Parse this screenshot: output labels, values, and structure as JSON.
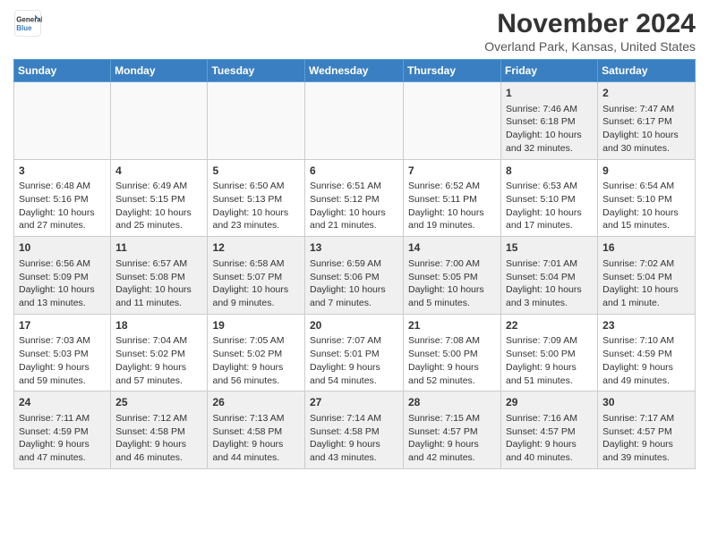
{
  "header": {
    "logo_line1": "General",
    "logo_line2": "Blue",
    "month": "November 2024",
    "location": "Overland Park, Kansas, United States"
  },
  "weekdays": [
    "Sunday",
    "Monday",
    "Tuesday",
    "Wednesday",
    "Thursday",
    "Friday",
    "Saturday"
  ],
  "weeks": [
    [
      {
        "day": "",
        "info": ""
      },
      {
        "day": "",
        "info": ""
      },
      {
        "day": "",
        "info": ""
      },
      {
        "day": "",
        "info": ""
      },
      {
        "day": "",
        "info": ""
      },
      {
        "day": "1",
        "info": "Sunrise: 7:46 AM\nSunset: 6:18 PM\nDaylight: 10 hours and 32 minutes."
      },
      {
        "day": "2",
        "info": "Sunrise: 7:47 AM\nSunset: 6:17 PM\nDaylight: 10 hours and 30 minutes."
      }
    ],
    [
      {
        "day": "3",
        "info": "Sunrise: 6:48 AM\nSunset: 5:16 PM\nDaylight: 10 hours and 27 minutes."
      },
      {
        "day": "4",
        "info": "Sunrise: 6:49 AM\nSunset: 5:15 PM\nDaylight: 10 hours and 25 minutes."
      },
      {
        "day": "5",
        "info": "Sunrise: 6:50 AM\nSunset: 5:13 PM\nDaylight: 10 hours and 23 minutes."
      },
      {
        "day": "6",
        "info": "Sunrise: 6:51 AM\nSunset: 5:12 PM\nDaylight: 10 hours and 21 minutes."
      },
      {
        "day": "7",
        "info": "Sunrise: 6:52 AM\nSunset: 5:11 PM\nDaylight: 10 hours and 19 minutes."
      },
      {
        "day": "8",
        "info": "Sunrise: 6:53 AM\nSunset: 5:10 PM\nDaylight: 10 hours and 17 minutes."
      },
      {
        "day": "9",
        "info": "Sunrise: 6:54 AM\nSunset: 5:10 PM\nDaylight: 10 hours and 15 minutes."
      }
    ],
    [
      {
        "day": "10",
        "info": "Sunrise: 6:56 AM\nSunset: 5:09 PM\nDaylight: 10 hours and 13 minutes."
      },
      {
        "day": "11",
        "info": "Sunrise: 6:57 AM\nSunset: 5:08 PM\nDaylight: 10 hours and 11 minutes."
      },
      {
        "day": "12",
        "info": "Sunrise: 6:58 AM\nSunset: 5:07 PM\nDaylight: 10 hours and 9 minutes."
      },
      {
        "day": "13",
        "info": "Sunrise: 6:59 AM\nSunset: 5:06 PM\nDaylight: 10 hours and 7 minutes."
      },
      {
        "day": "14",
        "info": "Sunrise: 7:00 AM\nSunset: 5:05 PM\nDaylight: 10 hours and 5 minutes."
      },
      {
        "day": "15",
        "info": "Sunrise: 7:01 AM\nSunset: 5:04 PM\nDaylight: 10 hours and 3 minutes."
      },
      {
        "day": "16",
        "info": "Sunrise: 7:02 AM\nSunset: 5:04 PM\nDaylight: 10 hours and 1 minute."
      }
    ],
    [
      {
        "day": "17",
        "info": "Sunrise: 7:03 AM\nSunset: 5:03 PM\nDaylight: 9 hours and 59 minutes."
      },
      {
        "day": "18",
        "info": "Sunrise: 7:04 AM\nSunset: 5:02 PM\nDaylight: 9 hours and 57 minutes."
      },
      {
        "day": "19",
        "info": "Sunrise: 7:05 AM\nSunset: 5:02 PM\nDaylight: 9 hours and 56 minutes."
      },
      {
        "day": "20",
        "info": "Sunrise: 7:07 AM\nSunset: 5:01 PM\nDaylight: 9 hours and 54 minutes."
      },
      {
        "day": "21",
        "info": "Sunrise: 7:08 AM\nSunset: 5:00 PM\nDaylight: 9 hours and 52 minutes."
      },
      {
        "day": "22",
        "info": "Sunrise: 7:09 AM\nSunset: 5:00 PM\nDaylight: 9 hours and 51 minutes."
      },
      {
        "day": "23",
        "info": "Sunrise: 7:10 AM\nSunset: 4:59 PM\nDaylight: 9 hours and 49 minutes."
      }
    ],
    [
      {
        "day": "24",
        "info": "Sunrise: 7:11 AM\nSunset: 4:59 PM\nDaylight: 9 hours and 47 minutes."
      },
      {
        "day": "25",
        "info": "Sunrise: 7:12 AM\nSunset: 4:58 PM\nDaylight: 9 hours and 46 minutes."
      },
      {
        "day": "26",
        "info": "Sunrise: 7:13 AM\nSunset: 4:58 PM\nDaylight: 9 hours and 44 minutes."
      },
      {
        "day": "27",
        "info": "Sunrise: 7:14 AM\nSunset: 4:58 PM\nDaylight: 9 hours and 43 minutes."
      },
      {
        "day": "28",
        "info": "Sunrise: 7:15 AM\nSunset: 4:57 PM\nDaylight: 9 hours and 42 minutes."
      },
      {
        "day": "29",
        "info": "Sunrise: 7:16 AM\nSunset: 4:57 PM\nDaylight: 9 hours and 40 minutes."
      },
      {
        "day": "30",
        "info": "Sunrise: 7:17 AM\nSunset: 4:57 PM\nDaylight: 9 hours and 39 minutes."
      }
    ]
  ]
}
